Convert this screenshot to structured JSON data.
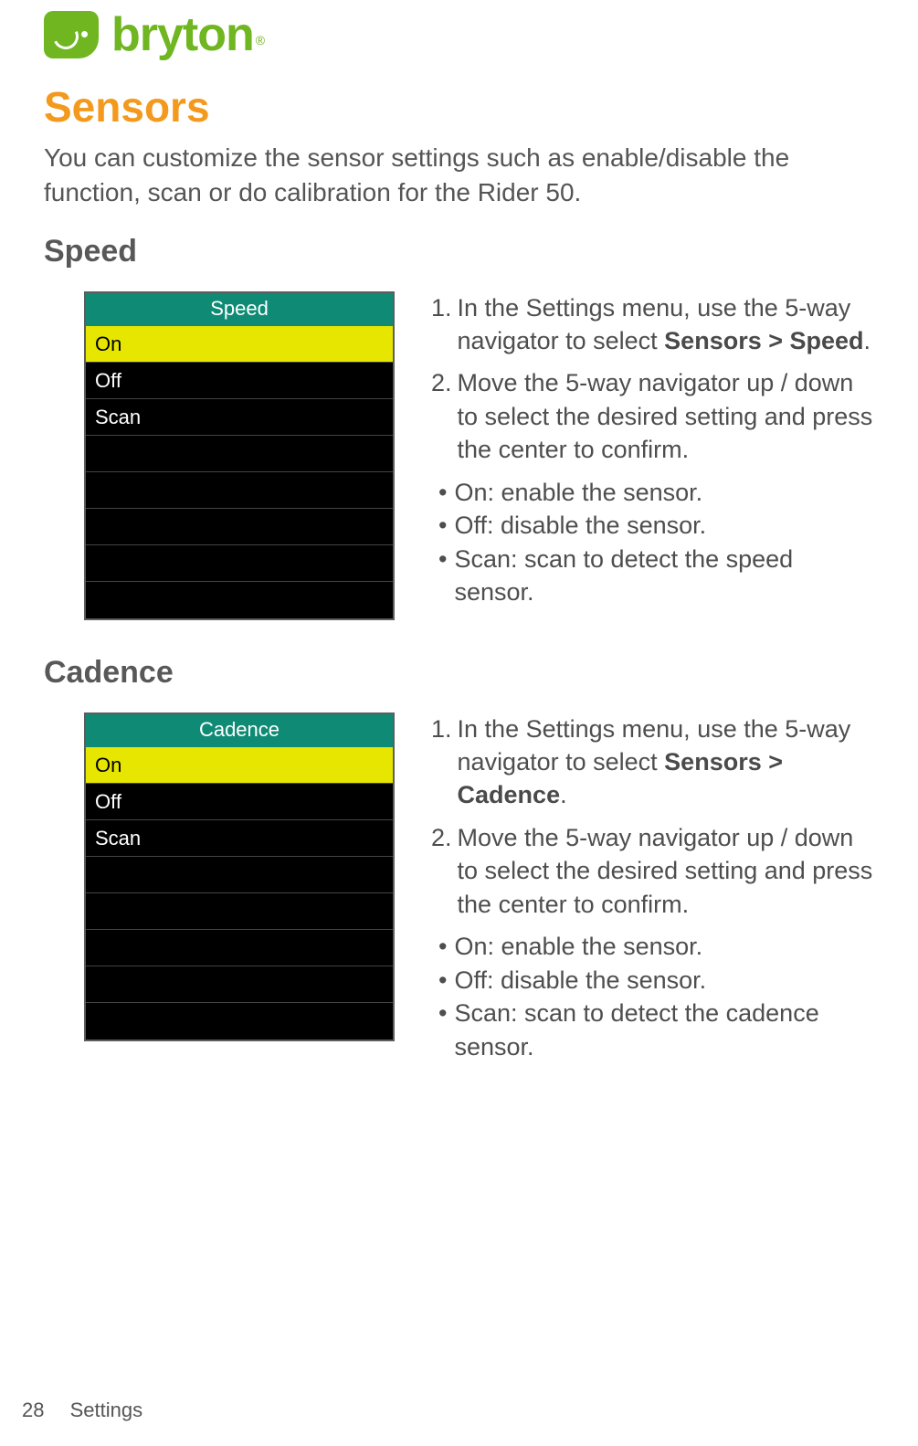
{
  "brand": {
    "name": "bryton",
    "reg": "®"
  },
  "title": "Sensors",
  "intro": "You can customize the sensor settings such as enable/disable the function, scan or do calibration for the Rider 50.",
  "speed": {
    "heading": "Speed",
    "device": {
      "title": "Speed",
      "rows": [
        "On",
        "Off",
        "Scan"
      ]
    },
    "steps": {
      "s1_pre": "In the Settings menu, use the 5-way navigator to select ",
      "s1_bold": "Sensors > Speed",
      "s1_post": ".",
      "s2": "Move the 5-way navigator up / down to select the desired setting and press the center to confirm.",
      "b1": "On: enable the sensor.",
      "b2": "Off: disable the sensor.",
      "b3": "Scan: scan to detect the speed sensor."
    }
  },
  "cadence": {
    "heading": "Cadence",
    "device": {
      "title": "Cadence",
      "rows": [
        "On",
        "Off",
        "Scan"
      ]
    },
    "steps": {
      "s1_pre": "In the Settings menu, use the 5-way navigator to select ",
      "s1_bold": "Sensors > Cadence",
      "s1_post": ".",
      "s2": "Move the 5-way navigator up / down to select the desired setting and press the center to confirm.",
      "b1": "On: enable the sensor.",
      "b2": "Off: disable the sensor.",
      "b3": "Scan: scan to detect the cadence sensor."
    }
  },
  "footer": {
    "page": "28",
    "section": "Settings"
  }
}
